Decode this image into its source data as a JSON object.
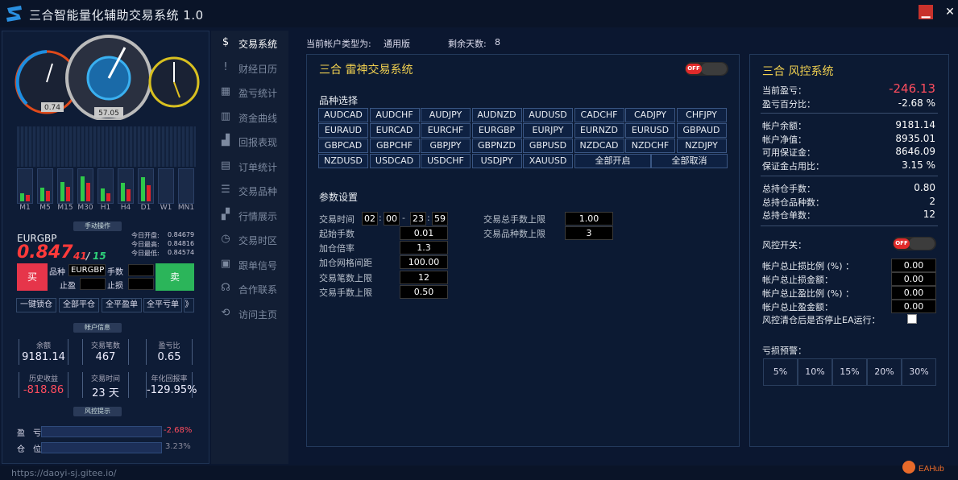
{
  "app": {
    "title": "三合智能量化辅助交易系统 1.0",
    "url": "https://daoyi-sj.gitee.io/"
  },
  "gauges": {
    "left_value": "0.74",
    "center_value": "57.05"
  },
  "timeframes": [
    "M1",
    "M5",
    "M15",
    "M30",
    "H1",
    "H4",
    "D1",
    "W1",
    "MN1"
  ],
  "manual": {
    "section": "手动操作",
    "symbol": "EURGBP",
    "price_main": "0.847",
    "price_d1": "41",
    "price_d2": "15",
    "open_label": "今日开盘:",
    "open": "0.84679",
    "high_label": "今日最高:",
    "high": "0.84816",
    "low_label": "今日最低:",
    "low": "0.84574",
    "buy": "买",
    "sell": "卖",
    "sym_label": "品种",
    "sym_value": "EURGBP",
    "lots_label": "手数",
    "sl_label": "止盈",
    "tp_label": "止损",
    "quick": [
      "一键锁仓",
      "全部平仓",
      "全平盈单",
      "全平亏单",
      "》"
    ]
  },
  "account": {
    "section": "帐户信息",
    "items": [
      {
        "label": "余额",
        "value": "9181.14"
      },
      {
        "label": "交易笔数",
        "value": "467"
      },
      {
        "label": "盈亏比",
        "value": "0.65"
      },
      {
        "label": "历史收益",
        "value": "-818.86"
      },
      {
        "label": "交易时间",
        "value": "23 天"
      },
      {
        "label": "年化回报率",
        "value": "-129.95%"
      }
    ]
  },
  "risk_hint": {
    "section": "风控提示",
    "pl_label": "盈　亏",
    "pl_value": "-2.68%",
    "pos_label": "仓　位",
    "pos_value": "3.23%"
  },
  "nav": [
    {
      "label": "交易系统",
      "icon": "$"
    },
    {
      "label": "财经日历",
      "icon": "!"
    },
    {
      "label": "盈亏统计",
      "icon": "▦"
    },
    {
      "label": "资金曲线",
      "icon": "▥"
    },
    {
      "label": "回报表现",
      "icon": "▟"
    },
    {
      "label": "订单统计",
      "icon": "▤"
    },
    {
      "label": "交易品种",
      "icon": "☰"
    },
    {
      "label": "行情展示",
      "icon": "▞"
    },
    {
      "label": "交易时区",
      "icon": "◷"
    },
    {
      "label": "跟单信号",
      "icon": "▣"
    },
    {
      "label": "合作联系",
      "icon": "☊"
    },
    {
      "label": "访问主页",
      "icon": "⟲"
    }
  ],
  "header": {
    "acct_type_label": "当前帐户类型为:",
    "acct_type": "通用版",
    "days_label": "剩余天数:",
    "days": "8"
  },
  "trading": {
    "title": "三合 雷神交易系统",
    "toggle": "OFF",
    "pairs_section": "品种选择",
    "pairs": [
      "AUDCAD",
      "AUDCHF",
      "AUDJPY",
      "AUDNZD",
      "AUDUSD",
      "CADCHF",
      "CADJPY",
      "CHFJPY",
      "EURAUD",
      "EURCAD",
      "EURCHF",
      "EURGBP",
      "EURJPY",
      "EURNZD",
      "EURUSD",
      "GBPAUD",
      "GBPCAD",
      "GBPCHF",
      "GBPJPY",
      "GBPNZD",
      "GBPUSD",
      "NZDCAD",
      "NZDCHF",
      "NZDJPY",
      "NZDUSD",
      "USDCAD",
      "USDCHF",
      "USDJPY",
      "XAUUSD"
    ],
    "select_all": "全部开启",
    "deselect_all": "全部取消",
    "params_section": "参数设置",
    "time_label": "交易时间",
    "time_start_h": "02",
    "time_start_m": "00",
    "time_end_h": "23",
    "time_end_m": "59",
    "params_left": [
      {
        "label": "起始手数",
        "value": "0.01"
      },
      {
        "label": "加仓倍率",
        "value": "1.3"
      },
      {
        "label": "加仓网格间距",
        "value": "100.00"
      },
      {
        "label": "交易笔数上限",
        "value": "12"
      },
      {
        "label": "交易手数上限",
        "value": "0.50"
      }
    ],
    "params_right": [
      {
        "label": "交易总手数上限",
        "value": "1.00"
      },
      {
        "label": "交易品种数上限",
        "value": "3"
      }
    ]
  },
  "risk": {
    "title": "三合  风控系统",
    "group1": [
      {
        "label": "当前盈亏：",
        "value": "-246.13",
        "color": "#ff4d5e"
      },
      {
        "label": "盈亏百分比：",
        "value": "-2.68 %"
      }
    ],
    "group2": [
      {
        "label": "帐户余额：",
        "value": "9181.14"
      },
      {
        "label": "帐户净值：",
        "value": "8935.01"
      },
      {
        "label": "可用保证金：",
        "value": "8646.09"
      },
      {
        "label": "保证金占用比：",
        "value": "3.15 %"
      }
    ],
    "group3": [
      {
        "label": "总持仓手数：",
        "value": "0.80"
      },
      {
        "label": "总持仓品种数：",
        "value": "2"
      },
      {
        "label": "总持仓单数：",
        "value": "12"
      }
    ],
    "switch_label": "风控开关：",
    "switch": "OFF",
    "limits": [
      {
        "label": "帐户总止损比例 (%) ：",
        "value": "0.00"
      },
      {
        "label": "帐户总止损金额：",
        "value": "0.00"
      },
      {
        "label": "帐户总止盈比例 (%) ：",
        "value": "0.00"
      },
      {
        "label": "帐户总止盈金额：",
        "value": "0.00"
      }
    ],
    "stop_ea_label": "风控清仓后是否停止EA运行：",
    "warn_label": "亏损预警：",
    "warn_levels": [
      "5%",
      "10%",
      "15%",
      "20%",
      "30%"
    ]
  },
  "colors": {
    "accent": "#f0d050",
    "buy": "#e6354a",
    "sell": "#2bb55a",
    "loss": "#ff4d5e"
  }
}
